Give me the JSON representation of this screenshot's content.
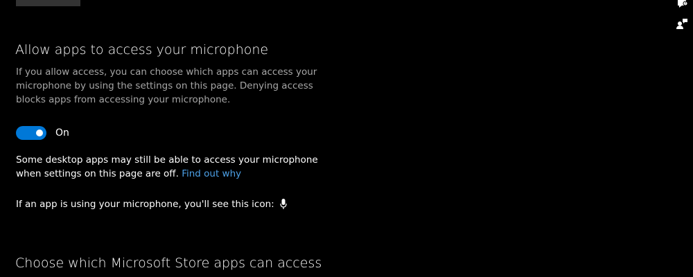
{
  "header": {
    "top_button_label": ""
  },
  "allow_section": {
    "title": "Allow apps to access your microphone",
    "description": "If you allow access, you can choose which apps can access your microphone by using the settings on this page. Denying access blocks apps from accessing your microphone.",
    "toggle_state": true,
    "toggle_label": "On"
  },
  "note": {
    "text": "Some desktop apps may still be able to access your microphone when settings on this page are off.",
    "link_text": "Find out why"
  },
  "icon_note": {
    "text": "If an app is using your microphone, you'll see this icon:",
    "icon": "microphone-icon"
  },
  "store_section": {
    "title": "Choose which Microsoft Store apps can access"
  },
  "side_icons": {
    "help": "help-icon",
    "feedback": "feedback-icon"
  },
  "colors": {
    "background": "#000000",
    "accent": "#0078d7",
    "link": "#4ca0e6",
    "muted_text": "#a6a6a6"
  }
}
